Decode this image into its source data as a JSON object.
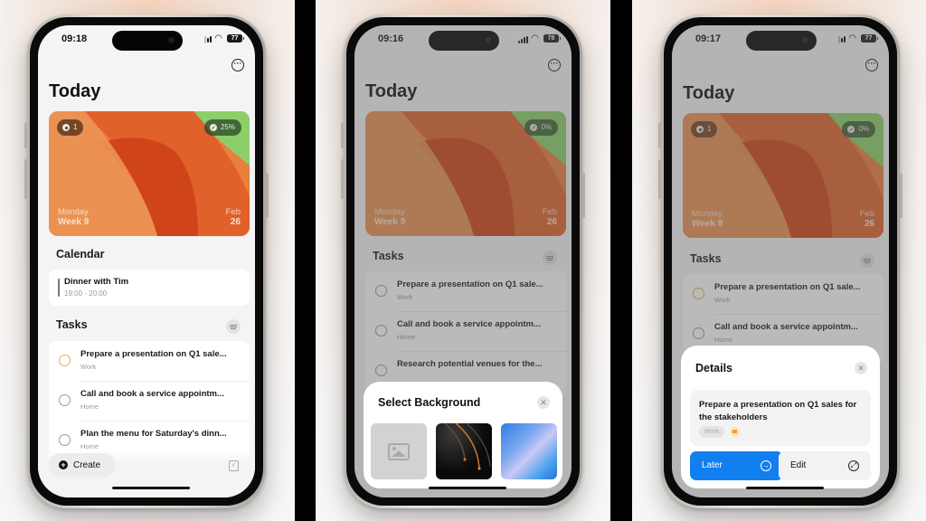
{
  "screens": [
    {
      "status": {
        "time": "09:18",
        "battery": "77"
      },
      "header": {
        "title": "Today",
        "more_icon": "ellipsis-circle-icon"
      },
      "card": {
        "badge_left": {
          "icon": "record-icon",
          "value": "1"
        },
        "badge_right": {
          "icon": "checkmark-circle-icon",
          "value": "25%"
        },
        "day": "Monday",
        "week": "Week 9",
        "month": "Feb",
        "date": "26",
        "colors": {
          "primary": "#e8652a",
          "accent": "#8ccf6a"
        }
      },
      "calendar": {
        "heading": "Calendar",
        "events": [
          {
            "title": "Dinner with Tim",
            "time": "19:00 - 20:00"
          }
        ]
      },
      "tasks": {
        "heading": "Tasks",
        "filter_icon": "filter-lines-icon",
        "items": [
          {
            "title": "Prepare a presentation on Q1 sale...",
            "category": "Work",
            "highlighted": true
          },
          {
            "title": "Call and book a service appointm...",
            "category": "Home",
            "highlighted": false
          },
          {
            "title": "Plan the menu for Saturday's dinn...",
            "category": "Home",
            "highlighted": false
          }
        ]
      },
      "bottom": {
        "create_label": "Create",
        "create_icon": "plus-circle-icon",
        "right_icon": "calendar-check-icon"
      }
    },
    {
      "status": {
        "time": "09:16",
        "battery": "78"
      },
      "header": {
        "title": "Today",
        "more_icon": "ellipsis-circle-icon"
      },
      "card": {
        "badge_right": {
          "icon": "checkmark-circle-icon",
          "value": "0%"
        },
        "day": "Monday",
        "week": "Week 9",
        "month": "Feb",
        "date": "26"
      },
      "tasks": {
        "heading": "Tasks",
        "items": [
          {
            "title": "Prepare a presentation on Q1 sale...",
            "category": "Work"
          },
          {
            "title": "Call and book a service appointm...",
            "category": "Home"
          },
          {
            "title": "Research potential venues for the...",
            "category": ""
          }
        ]
      },
      "sheet": {
        "title": "Select Background",
        "close_icon": "close-icon",
        "options": [
          {
            "name": "photo-library",
            "icon": "photo-icon"
          },
          {
            "name": "dark-curves"
          },
          {
            "name": "blue-gradient"
          }
        ]
      }
    },
    {
      "status": {
        "time": "09:17",
        "battery": "77"
      },
      "header": {
        "title": "Today",
        "more_icon": "ellipsis-circle-icon"
      },
      "card": {
        "badge_left": {
          "icon": "record-icon",
          "value": "1"
        },
        "badge_right": {
          "icon": "checkmark-circle-icon",
          "value": "0%"
        },
        "day": "Monday",
        "week": "Week 9",
        "month": "Feb",
        "date": "26"
      },
      "tasks": {
        "heading": "Tasks",
        "items": [
          {
            "title": "Prepare a presentation on Q1 sale...",
            "category": "Work",
            "highlighted": true
          },
          {
            "title": "Call and book a service appointm...",
            "category": "Home"
          }
        ]
      },
      "sheet": {
        "title": "Details",
        "close_icon": "close-icon",
        "task_title": "Prepare a presentation on Q1 sales for the stakeholders",
        "tag": "Work",
        "flag_icon": "flag-icon",
        "flag_color": "#f0a020",
        "later_label": "Later",
        "later_icon": "arrow-right-circle-icon",
        "edit_label": "Edit",
        "edit_icon": "expand-arrows-icon",
        "accent": "#127ff0"
      }
    }
  ]
}
